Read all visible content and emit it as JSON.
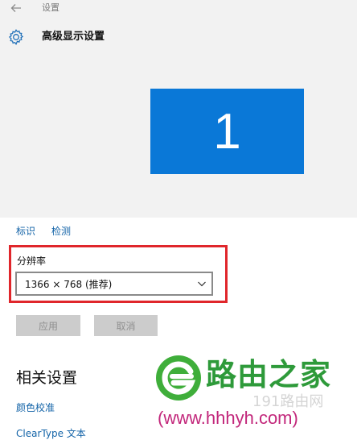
{
  "window": {
    "title": "设置"
  },
  "header": {
    "title": "高级显示设置"
  },
  "display": {
    "monitor_number": "1"
  },
  "links": {
    "identify": "标识",
    "detect": "检测"
  },
  "resolution": {
    "label": "分辨率",
    "selected": "1366 × 768 (推荐)"
  },
  "buttons": {
    "apply": "应用",
    "cancel": "取消"
  },
  "related": {
    "title": "相关设置",
    "items": [
      "颜色校准",
      "ClearType 文本"
    ]
  },
  "watermark": {
    "brand": "路由之家",
    "sub": "191路由网",
    "url": "(www.hhhyh.com)"
  },
  "colors": {
    "accent": "#0a78d7",
    "link": "#1464a8",
    "highlight": "#e0262b",
    "brand": "#2e9a3a",
    "url": "#c2277b"
  },
  "icons": {
    "back": "back-arrow-icon",
    "settings": "gear-icon",
    "dropdown": "chevron-down-icon"
  }
}
